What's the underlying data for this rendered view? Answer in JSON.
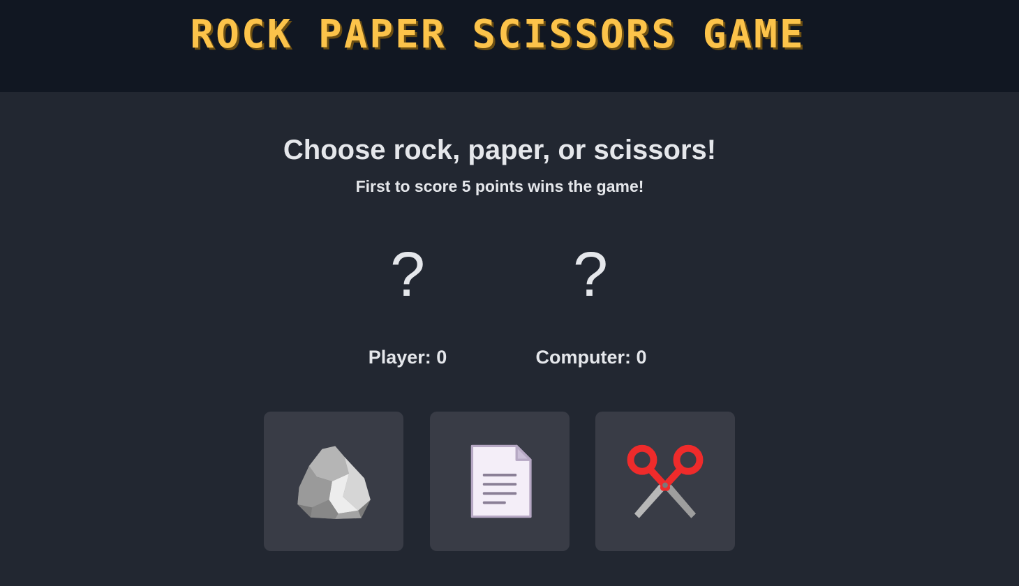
{
  "header": {
    "title": "ROCK PAPER SCISSORS GAME"
  },
  "main": {
    "headline": "Choose rock, paper, or scissors!",
    "subline": "First to score 5 points wins the game!"
  },
  "player": {
    "sign": "?",
    "score_label": "Player: 0",
    "score": 0
  },
  "computer": {
    "sign": "?",
    "score_label": "Computer: 0",
    "score": 0
  },
  "choices": [
    {
      "name": "rock",
      "icon": "rock-icon"
    },
    {
      "name": "paper",
      "icon": "paper-icon"
    },
    {
      "name": "scissors",
      "icon": "scissors-icon"
    }
  ],
  "colors": {
    "title": "#fcc34a",
    "header_bg": "#111722",
    "page_bg": "#222731",
    "button_bg": "#393c46",
    "text": "#e5e7eb",
    "scissors_handles": "#ef2b2b"
  }
}
